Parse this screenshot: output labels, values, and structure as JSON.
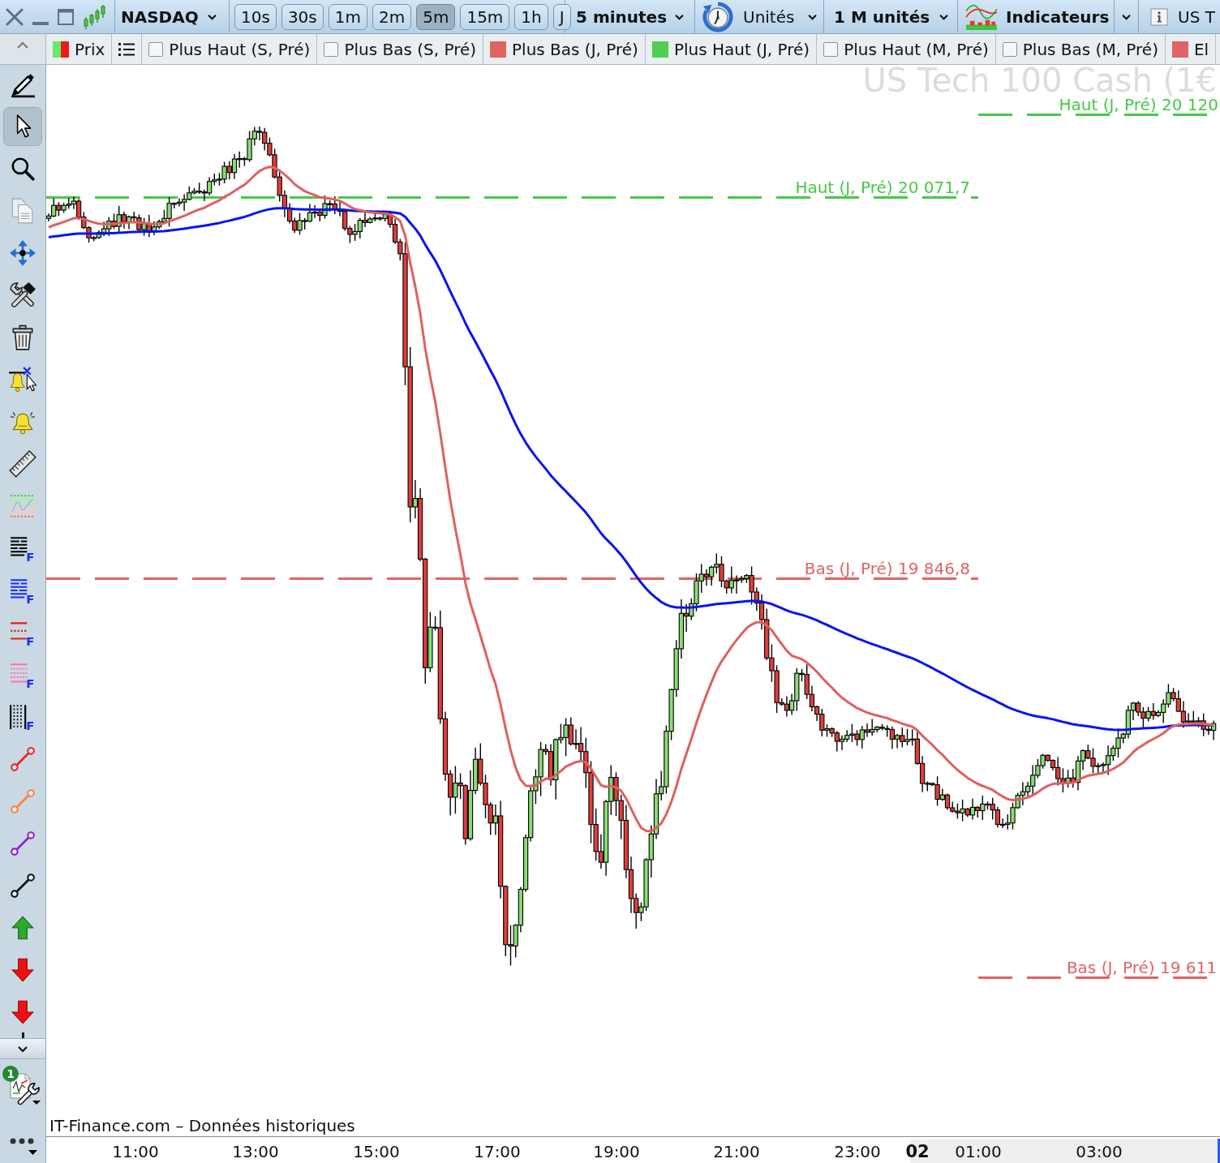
{
  "toolbar": {
    "instrument": "NASDAQ",
    "periods": [
      {
        "label": "10s",
        "selected": false
      },
      {
        "label": "30s",
        "selected": false
      },
      {
        "label": "1m",
        "selected": false
      },
      {
        "label": "2m",
        "selected": false
      },
      {
        "label": "5m",
        "selected": true
      },
      {
        "label": "15m",
        "selected": false
      },
      {
        "label": "1h",
        "selected": false
      },
      {
        "label": "J",
        "selected": false
      }
    ],
    "interval": "5 minutes",
    "units_label": "Unités",
    "units_value": "1 M unités",
    "indicators": "Indicateurs",
    "info_label": "US T"
  },
  "legend": {
    "items": [
      {
        "kind": "price",
        "label": "Prix"
      },
      {
        "kind": "list"
      },
      {
        "kind": "checkbox",
        "label": "Plus Haut (S, Pré)",
        "checked": false
      },
      {
        "kind": "checkbox",
        "label": "Plus Bas (S, Pré)",
        "checked": false
      },
      {
        "kind": "swatch",
        "label": "Plus Bas (J, Pré)",
        "color": "#e06464"
      },
      {
        "kind": "swatch",
        "label": "Plus Haut (J, Pré)",
        "color": "#4fcf4f"
      },
      {
        "kind": "checkbox",
        "label": "Plus Haut (M, Pré)",
        "checked": false
      },
      {
        "kind": "checkbox",
        "label": "Plus Bas (M, Pré)",
        "checked": false
      },
      {
        "kind": "swatch",
        "label": "El",
        "color": "#e06464"
      }
    ]
  },
  "left_toolbar": {
    "tools": [
      {
        "kind": "pencil",
        "selected": false
      },
      {
        "kind": "pointer",
        "selected": true
      },
      {
        "kind": "zoom",
        "selected": false
      },
      {
        "kind": "copy",
        "selected": false
      },
      {
        "kind": "move",
        "selected": false
      },
      {
        "kind": "tools",
        "selected": false
      },
      {
        "kind": "trash",
        "selected": false
      },
      {
        "kind": "alert-cursor",
        "selected": false
      },
      {
        "kind": "alert",
        "selected": false
      },
      {
        "kind": "ruler",
        "selected": false
      },
      {
        "kind": "zone",
        "selected": false
      },
      {
        "kind": "fib-text",
        "letter": "F",
        "selected": false
      },
      {
        "kind": "fib-blue",
        "letter": "F",
        "selected": false
      },
      {
        "kind": "fib-red",
        "letter": "F",
        "selected": false
      },
      {
        "kind": "fib-pink",
        "letter": "F",
        "selected": false
      },
      {
        "kind": "fib-time",
        "letter": "F",
        "selected": false
      },
      {
        "kind": "segment",
        "color": "#ee2222",
        "selected": false
      },
      {
        "kind": "segment",
        "color": "#ff8040",
        "selected": false
      },
      {
        "kind": "segment",
        "color": "#8a22cc",
        "selected": false
      },
      {
        "kind": "segment",
        "color": "#111111",
        "selected": false
      },
      {
        "kind": "arrow-up",
        "selected": false
      },
      {
        "kind": "arrow-down",
        "selected": false
      },
      {
        "kind": "arrow-down",
        "selected": false
      }
    ],
    "settings_badge": "1"
  },
  "chart": {
    "watermark": "US Tech 100 Cash (1€",
    "levels": [
      {
        "label": "Haut (J, Pré) 20 120",
        "color": "#46c946"
      },
      {
        "label": "Haut (J, Pré) 20 071,7",
        "color": "#46c946"
      },
      {
        "label": "Bas (J, Pré) 19 846,8",
        "color": "#e06464"
      },
      {
        "label": "Bas (J, Pré) 19 611",
        "color": "#e06464"
      }
    ],
    "source": "IT-Finance.com – Données historiques",
    "x_axis": [
      {
        "label": "11:00",
        "kind": "time"
      },
      {
        "label": "13:00",
        "kind": "time"
      },
      {
        "label": "15:00",
        "kind": "time"
      },
      {
        "label": "17:00",
        "kind": "time"
      },
      {
        "label": "19:00",
        "kind": "time"
      },
      {
        "label": "21:00",
        "kind": "time"
      },
      {
        "label": "23:00",
        "kind": "time"
      },
      {
        "label": "02",
        "kind": "day"
      },
      {
        "label": "01:00",
        "kind": "time"
      },
      {
        "label": "03:00",
        "kind": "time"
      }
    ]
  }
}
